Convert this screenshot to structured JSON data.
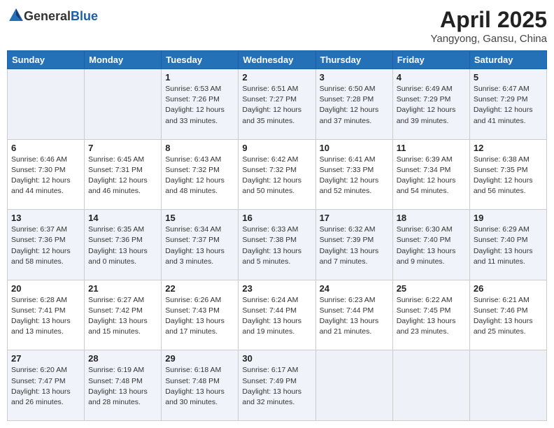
{
  "header": {
    "logo_general": "General",
    "logo_blue": "Blue",
    "month_year": "April 2025",
    "location": "Yangyong, Gansu, China"
  },
  "weekdays": [
    "Sunday",
    "Monday",
    "Tuesday",
    "Wednesday",
    "Thursday",
    "Friday",
    "Saturday"
  ],
  "weeks": [
    [
      {
        "day": "",
        "info": ""
      },
      {
        "day": "",
        "info": ""
      },
      {
        "day": "1",
        "info": "Sunrise: 6:53 AM\nSunset: 7:26 PM\nDaylight: 12 hours\nand 33 minutes."
      },
      {
        "day": "2",
        "info": "Sunrise: 6:51 AM\nSunset: 7:27 PM\nDaylight: 12 hours\nand 35 minutes."
      },
      {
        "day": "3",
        "info": "Sunrise: 6:50 AM\nSunset: 7:28 PM\nDaylight: 12 hours\nand 37 minutes."
      },
      {
        "day": "4",
        "info": "Sunrise: 6:49 AM\nSunset: 7:29 PM\nDaylight: 12 hours\nand 39 minutes."
      },
      {
        "day": "5",
        "info": "Sunrise: 6:47 AM\nSunset: 7:29 PM\nDaylight: 12 hours\nand 41 minutes."
      }
    ],
    [
      {
        "day": "6",
        "info": "Sunrise: 6:46 AM\nSunset: 7:30 PM\nDaylight: 12 hours\nand 44 minutes."
      },
      {
        "day": "7",
        "info": "Sunrise: 6:45 AM\nSunset: 7:31 PM\nDaylight: 12 hours\nand 46 minutes."
      },
      {
        "day": "8",
        "info": "Sunrise: 6:43 AM\nSunset: 7:32 PM\nDaylight: 12 hours\nand 48 minutes."
      },
      {
        "day": "9",
        "info": "Sunrise: 6:42 AM\nSunset: 7:32 PM\nDaylight: 12 hours\nand 50 minutes."
      },
      {
        "day": "10",
        "info": "Sunrise: 6:41 AM\nSunset: 7:33 PM\nDaylight: 12 hours\nand 52 minutes."
      },
      {
        "day": "11",
        "info": "Sunrise: 6:39 AM\nSunset: 7:34 PM\nDaylight: 12 hours\nand 54 minutes."
      },
      {
        "day": "12",
        "info": "Sunrise: 6:38 AM\nSunset: 7:35 PM\nDaylight: 12 hours\nand 56 minutes."
      }
    ],
    [
      {
        "day": "13",
        "info": "Sunrise: 6:37 AM\nSunset: 7:36 PM\nDaylight: 12 hours\nand 58 minutes."
      },
      {
        "day": "14",
        "info": "Sunrise: 6:35 AM\nSunset: 7:36 PM\nDaylight: 13 hours\nand 0 minutes."
      },
      {
        "day": "15",
        "info": "Sunrise: 6:34 AM\nSunset: 7:37 PM\nDaylight: 13 hours\nand 3 minutes."
      },
      {
        "day": "16",
        "info": "Sunrise: 6:33 AM\nSunset: 7:38 PM\nDaylight: 13 hours\nand 5 minutes."
      },
      {
        "day": "17",
        "info": "Sunrise: 6:32 AM\nSunset: 7:39 PM\nDaylight: 13 hours\nand 7 minutes."
      },
      {
        "day": "18",
        "info": "Sunrise: 6:30 AM\nSunset: 7:40 PM\nDaylight: 13 hours\nand 9 minutes."
      },
      {
        "day": "19",
        "info": "Sunrise: 6:29 AM\nSunset: 7:40 PM\nDaylight: 13 hours\nand 11 minutes."
      }
    ],
    [
      {
        "day": "20",
        "info": "Sunrise: 6:28 AM\nSunset: 7:41 PM\nDaylight: 13 hours\nand 13 minutes."
      },
      {
        "day": "21",
        "info": "Sunrise: 6:27 AM\nSunset: 7:42 PM\nDaylight: 13 hours\nand 15 minutes."
      },
      {
        "day": "22",
        "info": "Sunrise: 6:26 AM\nSunset: 7:43 PM\nDaylight: 13 hours\nand 17 minutes."
      },
      {
        "day": "23",
        "info": "Sunrise: 6:24 AM\nSunset: 7:44 PM\nDaylight: 13 hours\nand 19 minutes."
      },
      {
        "day": "24",
        "info": "Sunrise: 6:23 AM\nSunset: 7:44 PM\nDaylight: 13 hours\nand 21 minutes."
      },
      {
        "day": "25",
        "info": "Sunrise: 6:22 AM\nSunset: 7:45 PM\nDaylight: 13 hours\nand 23 minutes."
      },
      {
        "day": "26",
        "info": "Sunrise: 6:21 AM\nSunset: 7:46 PM\nDaylight: 13 hours\nand 25 minutes."
      }
    ],
    [
      {
        "day": "27",
        "info": "Sunrise: 6:20 AM\nSunset: 7:47 PM\nDaylight: 13 hours\nand 26 minutes."
      },
      {
        "day": "28",
        "info": "Sunrise: 6:19 AM\nSunset: 7:48 PM\nDaylight: 13 hours\nand 28 minutes."
      },
      {
        "day": "29",
        "info": "Sunrise: 6:18 AM\nSunset: 7:48 PM\nDaylight: 13 hours\nand 30 minutes."
      },
      {
        "day": "30",
        "info": "Sunrise: 6:17 AM\nSunset: 7:49 PM\nDaylight: 13 hours\nand 32 minutes."
      },
      {
        "day": "",
        "info": ""
      },
      {
        "day": "",
        "info": ""
      },
      {
        "day": "",
        "info": ""
      }
    ]
  ]
}
